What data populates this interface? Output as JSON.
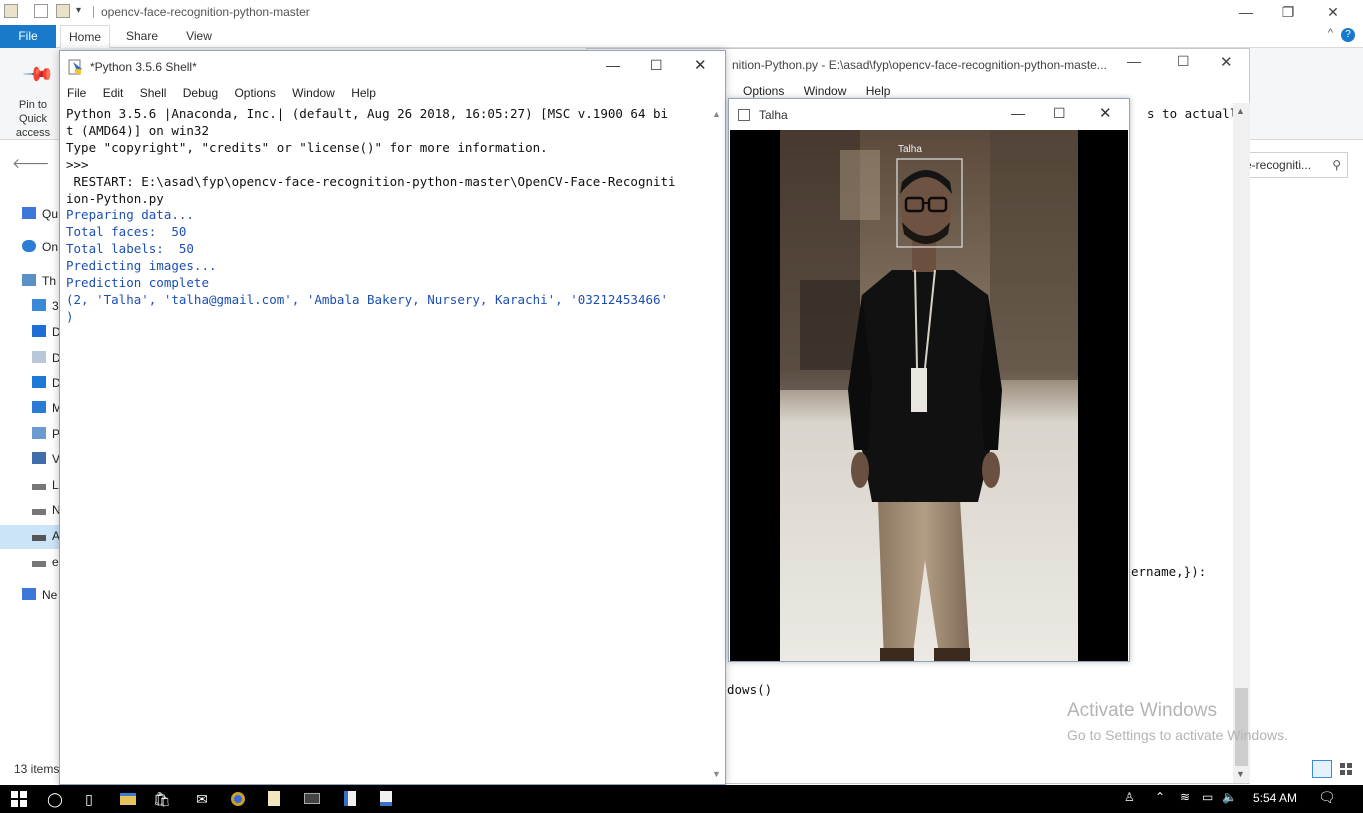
{
  "explorer": {
    "title": "opencv-face-recognition-python-master",
    "tabs": {
      "file": "File",
      "home": "Home",
      "share": "Share",
      "view": "View"
    },
    "help": "?",
    "collapse": "^",
    "pin_label": "Pin to Quick access",
    "right_search": "e-recogniti...",
    "nav_items": [
      "Qu",
      "On",
      "Th",
      "3",
      "D",
      "D",
      "D",
      "M",
      "P",
      "V",
      "L",
      "N",
      "A",
      "e",
      "Ne"
    ],
    "items_count": "13 items",
    "activate_title": "Activate Windows",
    "activate_sub": "Go to Settings to activate Windows."
  },
  "editor": {
    "title": "nition-Python.py - E:\\asad\\fyp\\opencv-face-recognition-python-maste...",
    "menu": [
      "Options",
      "Window",
      "Help"
    ],
    "line_top": "s to actuall",
    "line_mid": "ername,}):",
    "line_bottom": "dows()"
  },
  "shell": {
    "title": "*Python 3.5.6 Shell*",
    "menu": [
      "File",
      "Edit",
      "Shell",
      "Debug",
      "Options",
      "Window",
      "Help"
    ],
    "lines": [
      {
        "text": "Python 3.5.6 |Anaconda, Inc.| (default, Aug 26 2018, 16:05:27) [MSC v.1900 64 bi",
        "color": "black"
      },
      {
        "text": "t (AMD64)] on win32",
        "color": "black"
      },
      {
        "text": "Type \"copyright\", \"credits\" or \"license()\" for more information.",
        "color": "black"
      },
      {
        "text": ">>> ",
        "color": "black"
      },
      {
        "text": " RESTART: E:\\asad\\fyp\\opencv-face-recognition-python-master\\OpenCV-Face-Recogniti",
        "color": "black"
      },
      {
        "text": "ion-Python.py",
        "color": "black"
      },
      {
        "text": "Preparing data...",
        "color": "blue"
      },
      {
        "text": "Total faces:  50",
        "color": "blue"
      },
      {
        "text": "Total labels:  50",
        "color": "blue"
      },
      {
        "text": "Predicting images...",
        "color": "blue"
      },
      {
        "text": "Prediction complete",
        "color": "blue"
      },
      {
        "text": "(2, 'Talha', 'talha@gmail.com', 'Ambala Bakery, Nursery, Karachi', '03212453466'",
        "color": "blue"
      },
      {
        "text": ")",
        "color": "blue"
      }
    ]
  },
  "image_window": {
    "title": "Talha",
    "face_label": "Talha"
  },
  "taskbar": {
    "clock": "5:54 AM"
  },
  "colors": {
    "accent": "#1979ca",
    "shell_output_blue": "#1d4fb5",
    "taskbar": "#000000"
  }
}
